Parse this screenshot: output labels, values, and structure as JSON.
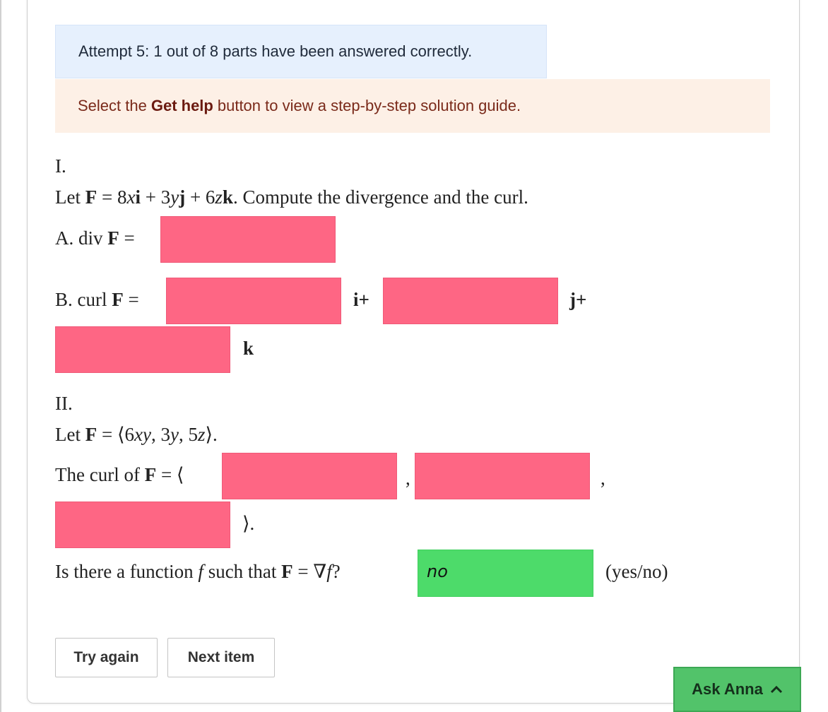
{
  "alerts": {
    "attempt": "Attempt 5: 1 out of 8 parts have been answered correctly.",
    "help_prefix": "Select the",
    "help_bold": "Get help",
    "help_suffix": "button to view a step-by-step solution guide."
  },
  "part1": {
    "label": "I.",
    "let": "Let",
    "F": "F",
    "eq": " = 8",
    "x": "x",
    "i": "i",
    "plus3": " + 3",
    "y": "y",
    "j": "j",
    "plus6": " + 6",
    "z": "z",
    "k": "k",
    "tail": ". Compute the divergence and the curl.",
    "a_label": "A. div",
    "b_label": "B. curl",
    "equals": "=",
    "i_plus": "i+",
    "j_plus": "j+",
    "k_end": "k"
  },
  "part2": {
    "label": "II.",
    "let": "Let",
    "F": "F",
    "eq_open": " = ⟨6",
    "xy": "xy",
    "comma3": ", 3",
    "y": "y",
    "comma5": ", 5",
    "z": "z",
    "close": "⟩.",
    "curl_text": "The curl of",
    "curl_eq": " = ⟨",
    "comma": ",",
    "end": "⟩.",
    "question_prefix": "Is there a function",
    "f": "f",
    "question_mid": "such that",
    "question_eq": " = ∇",
    "question_end": "?",
    "answer": "no",
    "hint": "(yes/no)"
  },
  "buttons": {
    "try_again": "Try again",
    "next_item": "Next item",
    "ask_anna": "Ask Anna"
  },
  "colors": {
    "incorrect": "#fe6684",
    "correct": "#4ddb6a",
    "ask_anna": "#52c36a"
  }
}
